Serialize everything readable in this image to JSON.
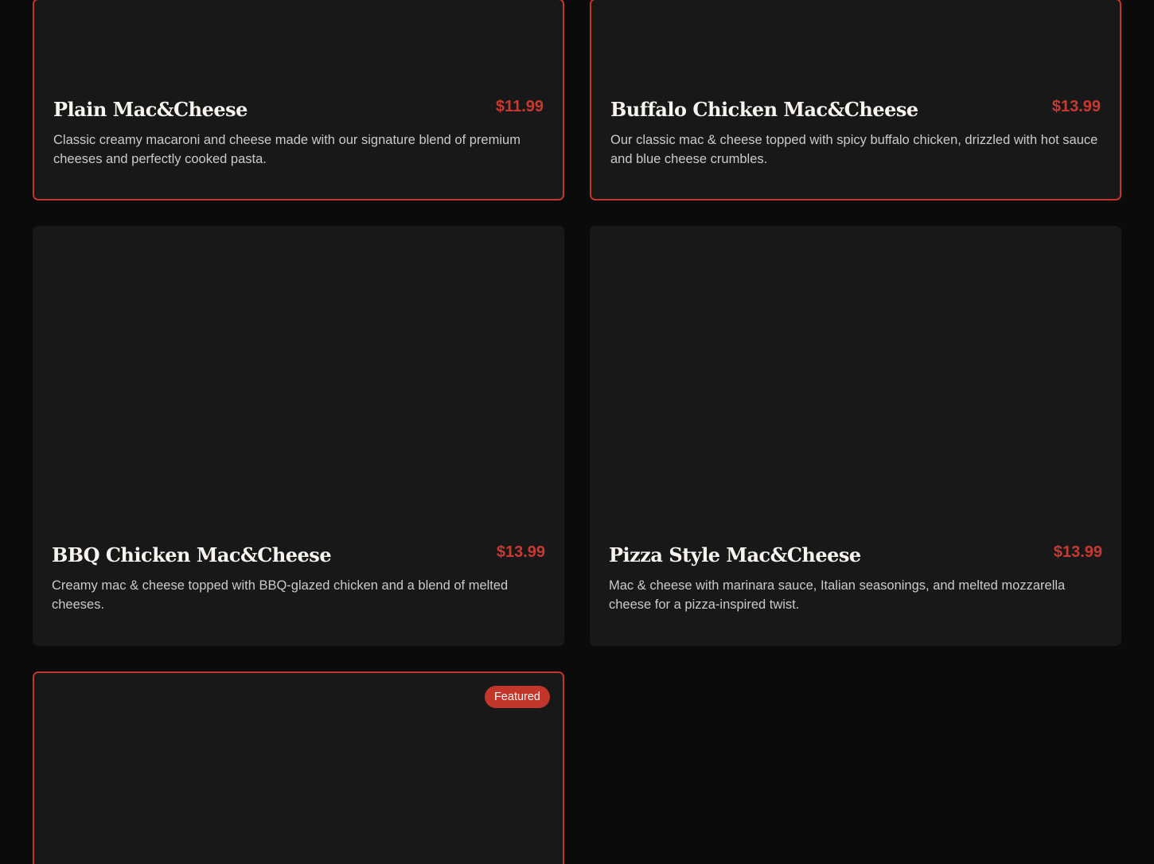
{
  "menu": {
    "items": [
      {
        "name": "Plain Mac&Cheese",
        "price": "$11.99",
        "description": "Classic creamy macaroni and cheese made with our signature blend of premium cheeses and perfectly cooked pasta."
      },
      {
        "name": "Buffalo Chicken Mac&Cheese",
        "price": "$13.99",
        "description": "Our classic mac & cheese topped with spicy buffalo chicken, drizzled with hot sauce and blue cheese crumbles."
      },
      {
        "name": "BBQ Chicken Mac&Cheese",
        "price": "$13.99",
        "description": "Creamy mac & cheese topped with BBQ-glazed chicken and a blend of melted cheeses."
      },
      {
        "name": "Pizza Style Mac&Cheese",
        "price": "$13.99",
        "description": "Mac & cheese with marinara sauce, Italian seasonings, and melted mozzarella cheese for a pizza-inspired twist."
      },
      {
        "badge": "Featured"
      }
    ]
  },
  "colors": {
    "page_background": "#0b0b0c",
    "card_background": "#181818",
    "accent": "#c2362b",
    "price": "#c9392f",
    "title": "#f7f4ef",
    "description": "#cdcac6"
  }
}
